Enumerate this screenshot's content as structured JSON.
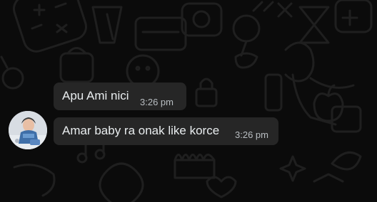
{
  "messages": [
    {
      "text": "Apu Ami nici",
      "time": "3:26 pm"
    },
    {
      "text": "Amar baby ra onak like korce",
      "time": "3:26 pm"
    }
  ],
  "sender": {
    "avatar_icon": "baby-photo-avatar"
  },
  "colors": {
    "background": "#0b0b0b",
    "doodle": "#1e1e1e",
    "bubble": "#262626",
    "text": "#e9edef",
    "time": "#b9bec2"
  }
}
